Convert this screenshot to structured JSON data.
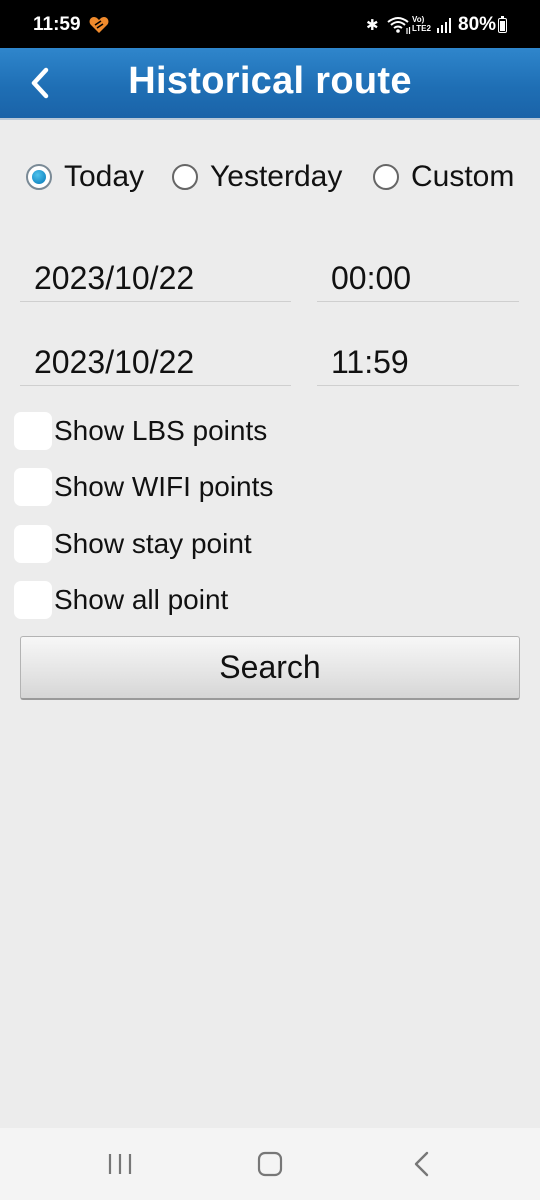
{
  "status_bar": {
    "time": "11:59",
    "battery": "80%",
    "network_label_top": "Vo)",
    "network_label_bottom": "LTE2",
    "icons": [
      "app-heart-icon",
      "bluetooth-icon",
      "wifi-icon",
      "signal-icon",
      "battery-icon"
    ]
  },
  "header": {
    "title": "Historical route",
    "back_icon": "chevron-left-icon",
    "bg_color": "#1f6fb5"
  },
  "range": {
    "options": [
      {
        "label": "Today",
        "selected": true
      },
      {
        "label": "Yesterday",
        "selected": false
      },
      {
        "label": "Custom",
        "selected": false
      }
    ],
    "accent_color": "#1a8ec8"
  },
  "start": {
    "date": "2023/10/22",
    "time": "00:00"
  },
  "end": {
    "date": "2023/10/22",
    "time": "11:59"
  },
  "options": {
    "lbs": {
      "label": "Show LBS points",
      "checked": false
    },
    "wifi": {
      "label": "Show WIFI points",
      "checked": false
    },
    "stay": {
      "label": "Show stay point",
      "checked": false
    },
    "all": {
      "label": "Show all point",
      "checked": false
    }
  },
  "search_button": {
    "label": "Search"
  },
  "nav_bar": {
    "icons": [
      "recent-apps-icon",
      "home-icon",
      "back-icon"
    ]
  }
}
